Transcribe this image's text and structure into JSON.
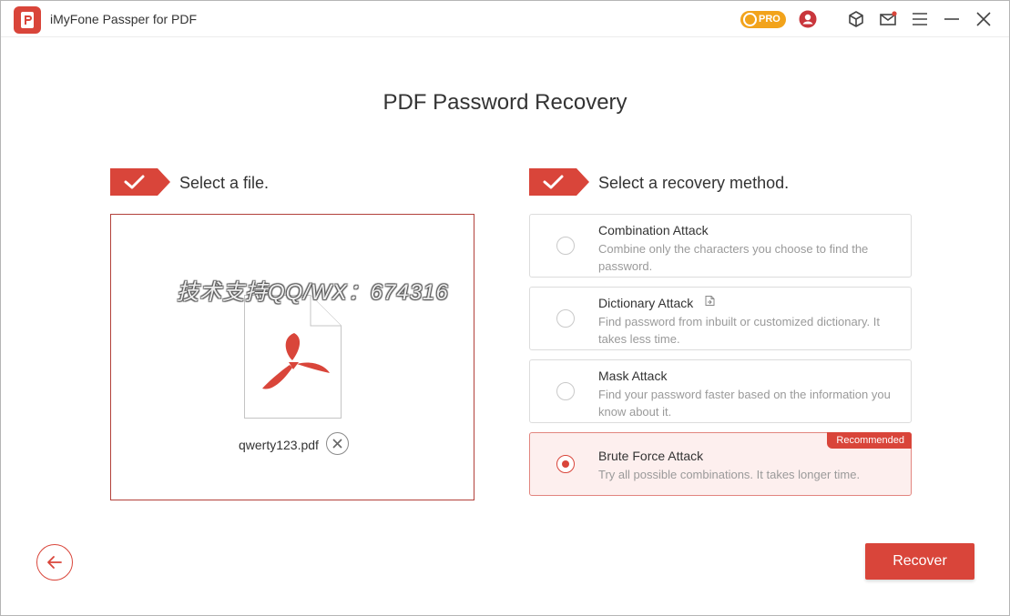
{
  "app": {
    "title": "iMyFone Passper for PDF",
    "pro_label": "PRO",
    "icons": {
      "logo": "passper-logo-icon",
      "account": "user-account-icon",
      "package": "cube-icon",
      "mail": "mail-icon",
      "menu": "hamburger-menu-icon",
      "minimize": "minimize-icon",
      "close": "close-icon"
    }
  },
  "page": {
    "title": "PDF Password Recovery"
  },
  "steps": {
    "file": {
      "label": "Select a file."
    },
    "method": {
      "label": "Select a recovery method."
    }
  },
  "file_panel": {
    "file_name": "qwerty123.pdf",
    "watermark": "技术支持QQ/WX：674316",
    "icons": {
      "document": "pdf-file-icon",
      "remove": "remove-file-icon"
    }
  },
  "methods": [
    {
      "title": "Combination Attack",
      "description": "Combine only the characters you choose to find the password.",
      "selected": false
    },
    {
      "title": "Dictionary Attack",
      "description": "Find password from inbuilt or customized dictionary. It takes less time.",
      "selected": false
    },
    {
      "title": "Mask Attack",
      "description": "Find your password faster based on the information you know about it.",
      "selected": false
    },
    {
      "title": "Brute Force Attack",
      "description": "Try all possible combinations. It takes longer time.",
      "selected": true,
      "badge": "Recommended"
    }
  ],
  "actions": {
    "recover_label": "Recover",
    "back_icon": "arrow-left-icon"
  },
  "colors": {
    "accent": "#d9453a",
    "pro": "#f2a31b",
    "selected_bg": "#fdefee"
  }
}
